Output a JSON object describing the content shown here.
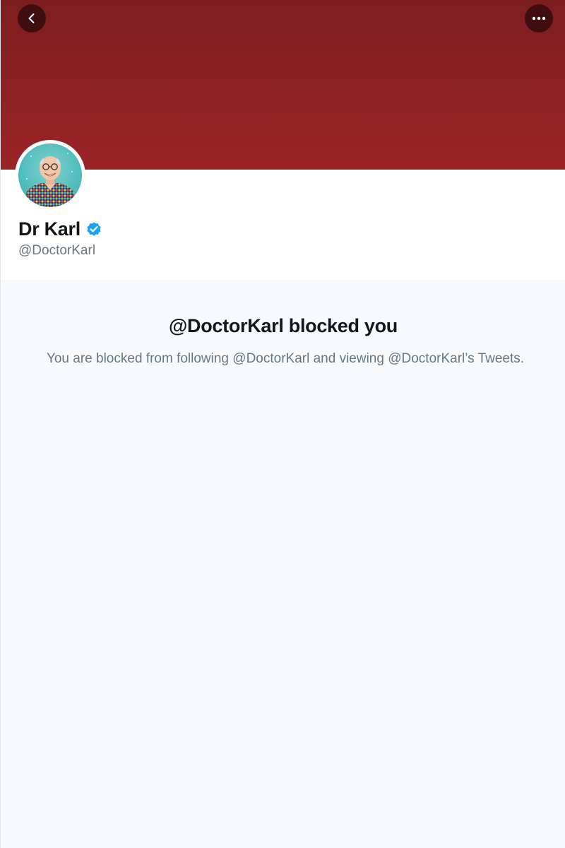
{
  "header": {
    "back_icon": "chevron-left-icon",
    "more_icon": "more-horizontal-icon",
    "banner_color": "#8e2124"
  },
  "profile": {
    "display_name": "Dr Karl",
    "handle": "@DoctorKarl",
    "verified": true,
    "verified_color": "#1da1f2",
    "avatar_icon": "profile-photo"
  },
  "blocked": {
    "title": "@DoctorKarl blocked you",
    "description": "You are blocked from following @DoctorKarl and viewing @DoctorKarl’s Tweets."
  },
  "colors": {
    "text_primary": "#14171a",
    "text_secondary": "#657786",
    "background": "#f7f9fa"
  }
}
